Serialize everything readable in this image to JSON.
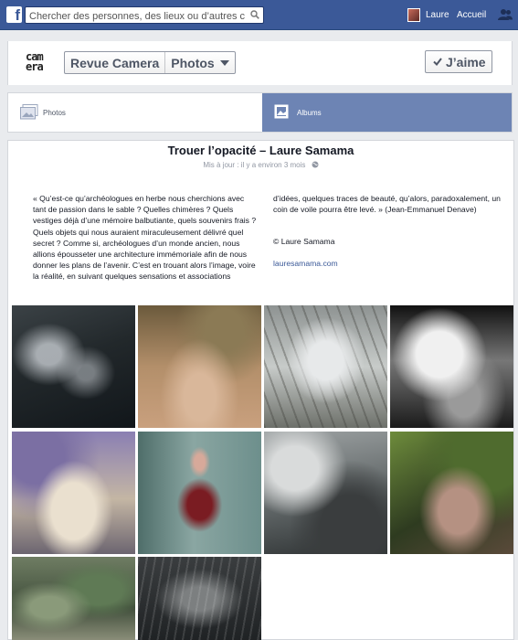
{
  "topbar": {
    "logo": "f",
    "search_placeholder": "Chercher des personnes, des lieux ou d’autres choses",
    "user_name": "Laure",
    "home_label": "Accueil",
    "icons": [
      "search-icon",
      "friends-icon"
    ]
  },
  "page": {
    "logo_text_1": "cam",
    "logo_text_2": "era",
    "breadcrumb": [
      "Revue Camera",
      "Photos"
    ],
    "like_label": "J’aime"
  },
  "tabs": [
    {
      "label": "Photos",
      "active": false
    },
    {
      "label": "Albums",
      "active": true
    }
  ],
  "album": {
    "title": "Trouer l’opacité – Laure Samama",
    "meta": "Mis à jour : il y a environ 3 mois",
    "description_left": "« Qu’est-ce qu’archéologues en herbe nous cherchions avec tant de passion dans le sable ? Quelles chimères ? Quels vestiges déjà d’une mémoire balbutiante, quels souvenirs frais ? Quels objets qui nous auraient miraculeusement délivré quel secret ? Comme si, archéologues d’un monde ancien, nous allions épousseter une architecture immémoriale afin de nous donner les plans de l’avenir. C’est en trouant alors l’image, voire la réalité, en suivant quelques sensations et associations",
    "description_right": "d’idées, quelques traces de beauté, qu’alors, paradoxalement, un coin de voile pourra être levé. » (Jean-Emmanuel Denave)",
    "credit": "© Laure Samama",
    "link": "lauresamama.com",
    "photo_count_visible": 10
  },
  "colors": {
    "brand": "#3b5998",
    "active_tab": "#6d84b4",
    "background": "#e9ebee"
  }
}
